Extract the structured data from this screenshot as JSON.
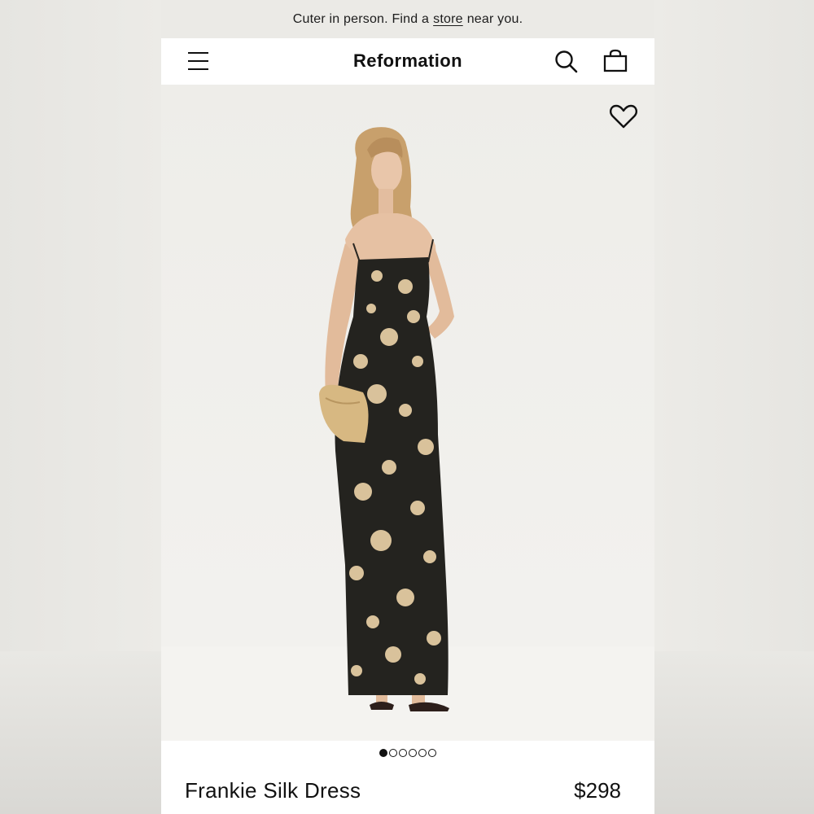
{
  "promo": {
    "before": "Cuter in person. Find a",
    "link": "store",
    "after": "near you."
  },
  "header": {
    "brand": "Reformation",
    "menu_icon": "hamburger-menu-icon",
    "search_icon": "search-icon",
    "bag_icon": "shopping-bag-icon"
  },
  "gallery": {
    "favorite_icon": "heart-icon",
    "image_alt": "Model wearing black floral slip maxi dress",
    "slide_count": 6,
    "active_slide": 1
  },
  "product": {
    "name": "Frankie Silk Dress",
    "price": "$298"
  }
}
